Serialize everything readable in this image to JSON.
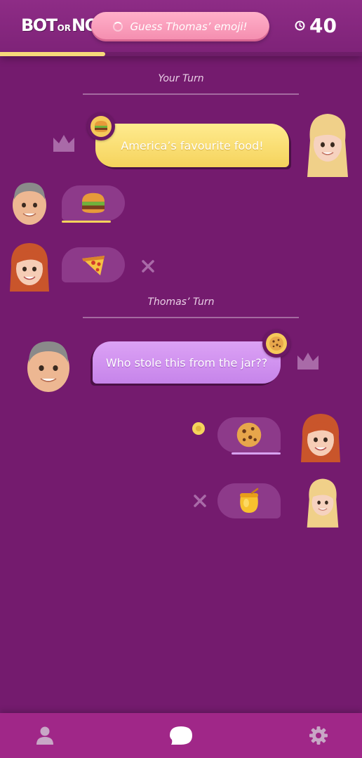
{
  "header": {
    "logo_big1": "BOT",
    "logo_small": "OR",
    "logo_big2": "NOT",
    "prompt": "Guess Thomas’ emoji!",
    "timer": "40",
    "progress_fraction": 0.29
  },
  "sections": [
    {
      "title": "Your Turn"
    },
    {
      "title": "Thomas’ Turn"
    }
  ],
  "round1": {
    "clue": "America’s favourite food!",
    "clue_emoji": "burger",
    "guesses": [
      {
        "player": "Thomas",
        "emoji": "burger",
        "result": "correct"
      },
      {
        "player": "Red-haired player",
        "emoji": "pizza",
        "result": "wrong"
      }
    ]
  },
  "round2": {
    "clue": "Who stole this from the jar??",
    "clue_emoji": "cookie",
    "guesses": [
      {
        "player": "Red-haired player",
        "emoji": "cookie",
        "result": "correct"
      },
      {
        "player": "You",
        "emoji": "honey-pot",
        "result": "wrong"
      }
    ]
  },
  "colors": {
    "background": "#741b6e",
    "yellow_bubble": "#f5d35c",
    "lilac_bubble": "#c684ea",
    "guess_bubble": "#8d3a8a",
    "nav": "#a02788",
    "prompt_pill": "#f48cae"
  },
  "icons": {
    "crown": "crown-icon",
    "wrong": "x-icon",
    "nav": [
      "profile-icon",
      "chat-icon",
      "settings-icon"
    ]
  }
}
